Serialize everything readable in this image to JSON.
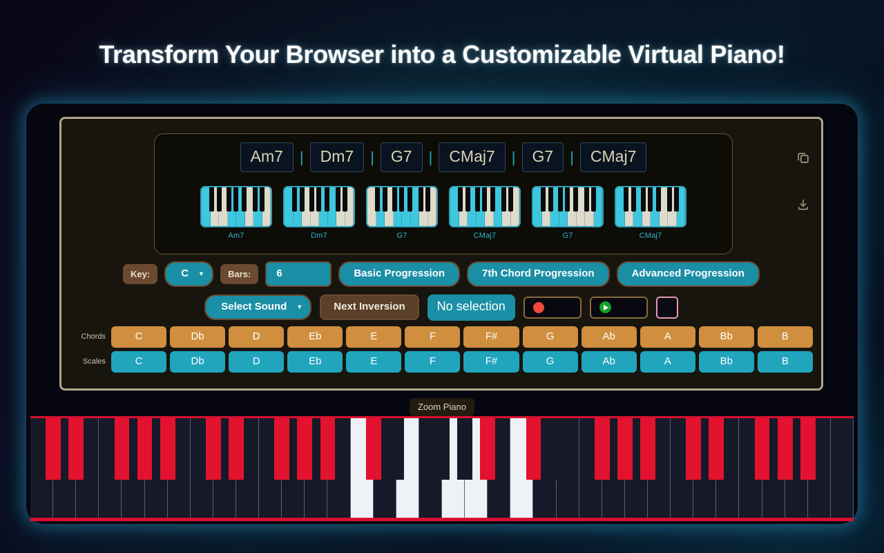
{
  "headline": "Transform Your Browser into a Customizable Virtual Piano!",
  "chord_progression": {
    "separator": "|",
    "chords": [
      "Am7",
      "Dm7",
      "G7",
      "CMaj7",
      "G7",
      "CMaj7"
    ],
    "mini_keyboard_labels": [
      "Am7",
      "Dm7",
      "G7",
      "CMaj7",
      "G7",
      "CMaj7"
    ],
    "copy_icon": "copy-icon",
    "download_icon": "download-icon"
  },
  "controls": {
    "key_label": "Key:",
    "key_value": "C",
    "bars_label": "Bars:",
    "bars_value": "6",
    "basic_progression": "Basic Progression",
    "seventh_chord_progression": "7th Chord Progression",
    "advanced_progression": "Advanced Progression",
    "select_sound": "Select Sound",
    "next_inversion": "Next Inversion",
    "selection_status": "No selection",
    "record_icon": "record-icon",
    "play_icon": "play-icon",
    "color_swatch": "color-swatch"
  },
  "note_grids": {
    "chords_label": "Chords",
    "scales_label": "Scales",
    "notes": [
      "C",
      "Db",
      "D",
      "Eb",
      "E",
      "F",
      "F#",
      "G",
      "Ab",
      "A",
      "Bb",
      "B"
    ]
  },
  "zoom_piano_label": "Zoom Piano",
  "colors": {
    "teal": "#1b8fa6",
    "chords_orange": "#cf8f3f",
    "scales_cyan": "#21a5bd",
    "piano_red": "#e3122f",
    "brown_border": "#6b4a30",
    "panel_border": "#b3a68c",
    "record_red": "#f4493d",
    "play_green": "#18a02a",
    "swatch_pink": "#e89ab3"
  },
  "piano": {
    "white_key_count": 36,
    "active_white_keys": [
      14,
      16,
      18,
      19,
      21
    ]
  }
}
